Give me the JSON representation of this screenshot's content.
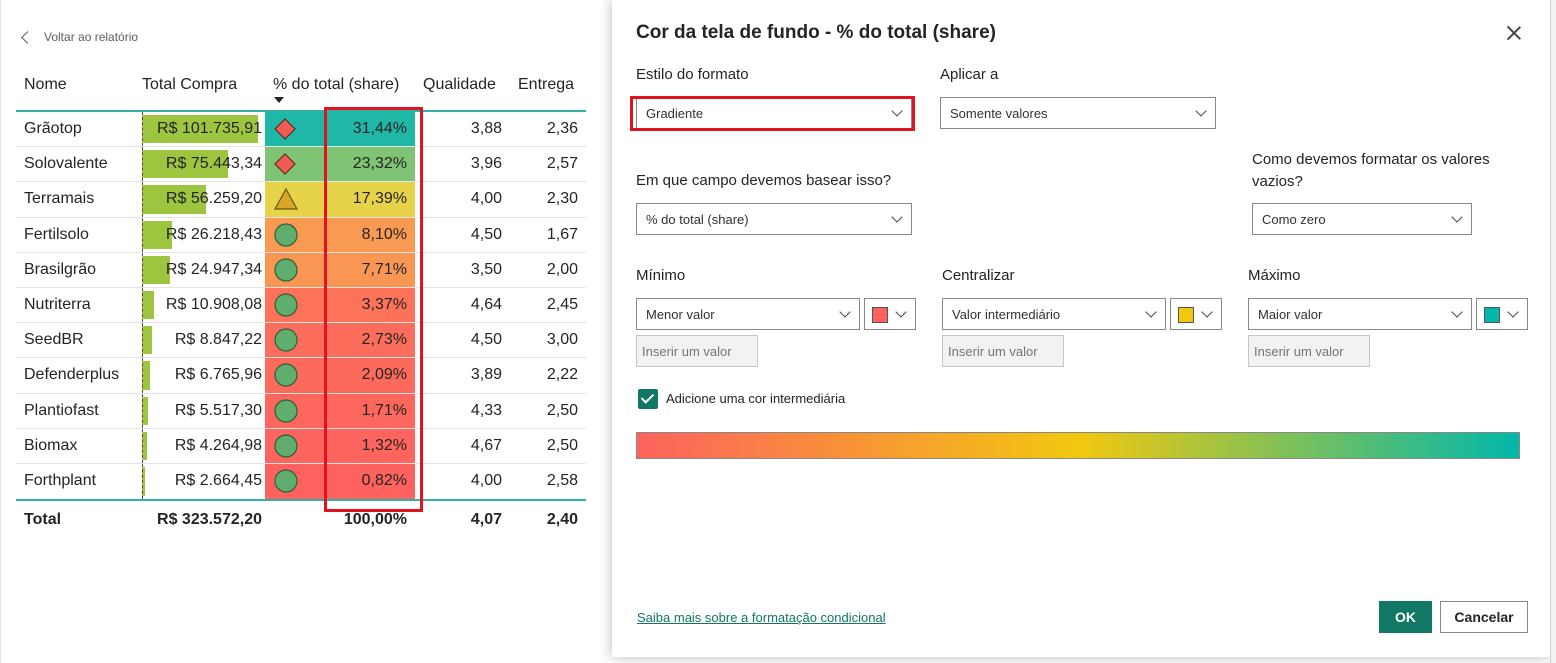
{
  "report": {
    "back_label": "Voltar ao relatório",
    "columns": [
      "Nome",
      "Total Compra",
      "% do total (share)",
      "Qualidade",
      "Entrega"
    ],
    "rows": [
      {
        "nome": "Grãotop",
        "compra": "R$ 101.735,91",
        "compra_pct": 1.0,
        "icon": "diamond",
        "share": "31,44%",
        "share_color": "#1fb8a6",
        "qual": "3,88",
        "ent": "2,36"
      },
      {
        "nome": "Solovalente",
        "compra": "R$ 75.443,34",
        "compra_pct": 0.74,
        "icon": "diamond",
        "share": "23,32%",
        "share_color": "#7ec474",
        "qual": "3,96",
        "ent": "2,57"
      },
      {
        "nome": "Terramais",
        "compra": "R$ 56.259,20",
        "compra_pct": 0.55,
        "icon": "triangle",
        "share": "17,39%",
        "share_color": "#e6d34a",
        "qual": "4,00",
        "ent": "2,30"
      },
      {
        "nome": "Fertilsolo",
        "compra": "R$ 26.218,43",
        "compra_pct": 0.26,
        "icon": "circle",
        "share": "8,10%",
        "share_color": "#f99a52",
        "qual": "4,50",
        "ent": "1,67"
      },
      {
        "nome": "Brasilgrão",
        "compra": "R$ 24.947,34",
        "compra_pct": 0.245,
        "icon": "circle",
        "share": "7,71%",
        "share_color": "#fa9654",
        "qual": "3,50",
        "ent": "2,00"
      },
      {
        "nome": "Nutriterra",
        "compra": "R$ 10.908,08",
        "compra_pct": 0.107,
        "icon": "circle",
        "share": "3,37%",
        "share_color": "#fc7359",
        "qual": "4,64",
        "ent": "2,45"
      },
      {
        "nome": "SeedBR",
        "compra": "R$ 8.847,22",
        "compra_pct": 0.087,
        "icon": "circle",
        "share": "2,73%",
        "share_color": "#fc6e5b",
        "qual": "4,50",
        "ent": "3,00"
      },
      {
        "nome": "Defenderplus",
        "compra": "R$ 6.765,96",
        "compra_pct": 0.066,
        "icon": "circle",
        "share": "2,09%",
        "share_color": "#fd6a5c",
        "qual": "3,89",
        "ent": "2,22"
      },
      {
        "nome": "Plantiofast",
        "compra": "R$ 5.517,30",
        "compra_pct": 0.054,
        "icon": "circle",
        "share": "1,71%",
        "share_color": "#fd675d",
        "qual": "4,33",
        "ent": "2,50"
      },
      {
        "nome": "Biomax",
        "compra": "R$ 4.264,98",
        "compra_pct": 0.042,
        "icon": "circle",
        "share": "1,32%",
        "share_color": "#fd655e",
        "qual": "4,67",
        "ent": "2,50"
      },
      {
        "nome": "Forthplant",
        "compra": "R$ 2.664,45",
        "compra_pct": 0.026,
        "icon": "circle",
        "share": "0,82%",
        "share_color": "#fe625f",
        "qual": "4,00",
        "ent": "2,58"
      }
    ],
    "total": {
      "label": "Total",
      "compra": "R$ 323.572,20",
      "share": "100,00%",
      "qual": "4,07",
      "ent": "2,40"
    }
  },
  "dialog": {
    "title": "Cor da tela de fundo - % do total (share)",
    "format_style_label": "Estilo do formato",
    "format_style_value": "Gradiente",
    "apply_to_label": "Aplicar a",
    "apply_to_value": "Somente valores",
    "base_field_label": "Em que campo devemos basear isso?",
    "base_field_value": "% do total (share)",
    "empty_values_label": "Como devemos formatar os valores vazios?",
    "empty_values_value": "Como zero",
    "min": {
      "label": "Mínimo",
      "value": "Menor valor",
      "color": "#fd625e",
      "placeholder": "Inserir um valor"
    },
    "center": {
      "label": "Centralizar",
      "value": "Valor intermediário",
      "color": "#f2c80f",
      "placeholder": "Inserir um valor"
    },
    "max": {
      "label": "Máximo",
      "value": "Maior valor",
      "color": "#01b8aa",
      "placeholder": "Inserir um valor"
    },
    "middle_color_label": "Adicione uma cor intermediária",
    "middle_color_checked": true,
    "learn_more": "Saiba mais sobre a formatação condicional",
    "ok_label": "OK",
    "cancel_label": "Cancelar"
  }
}
